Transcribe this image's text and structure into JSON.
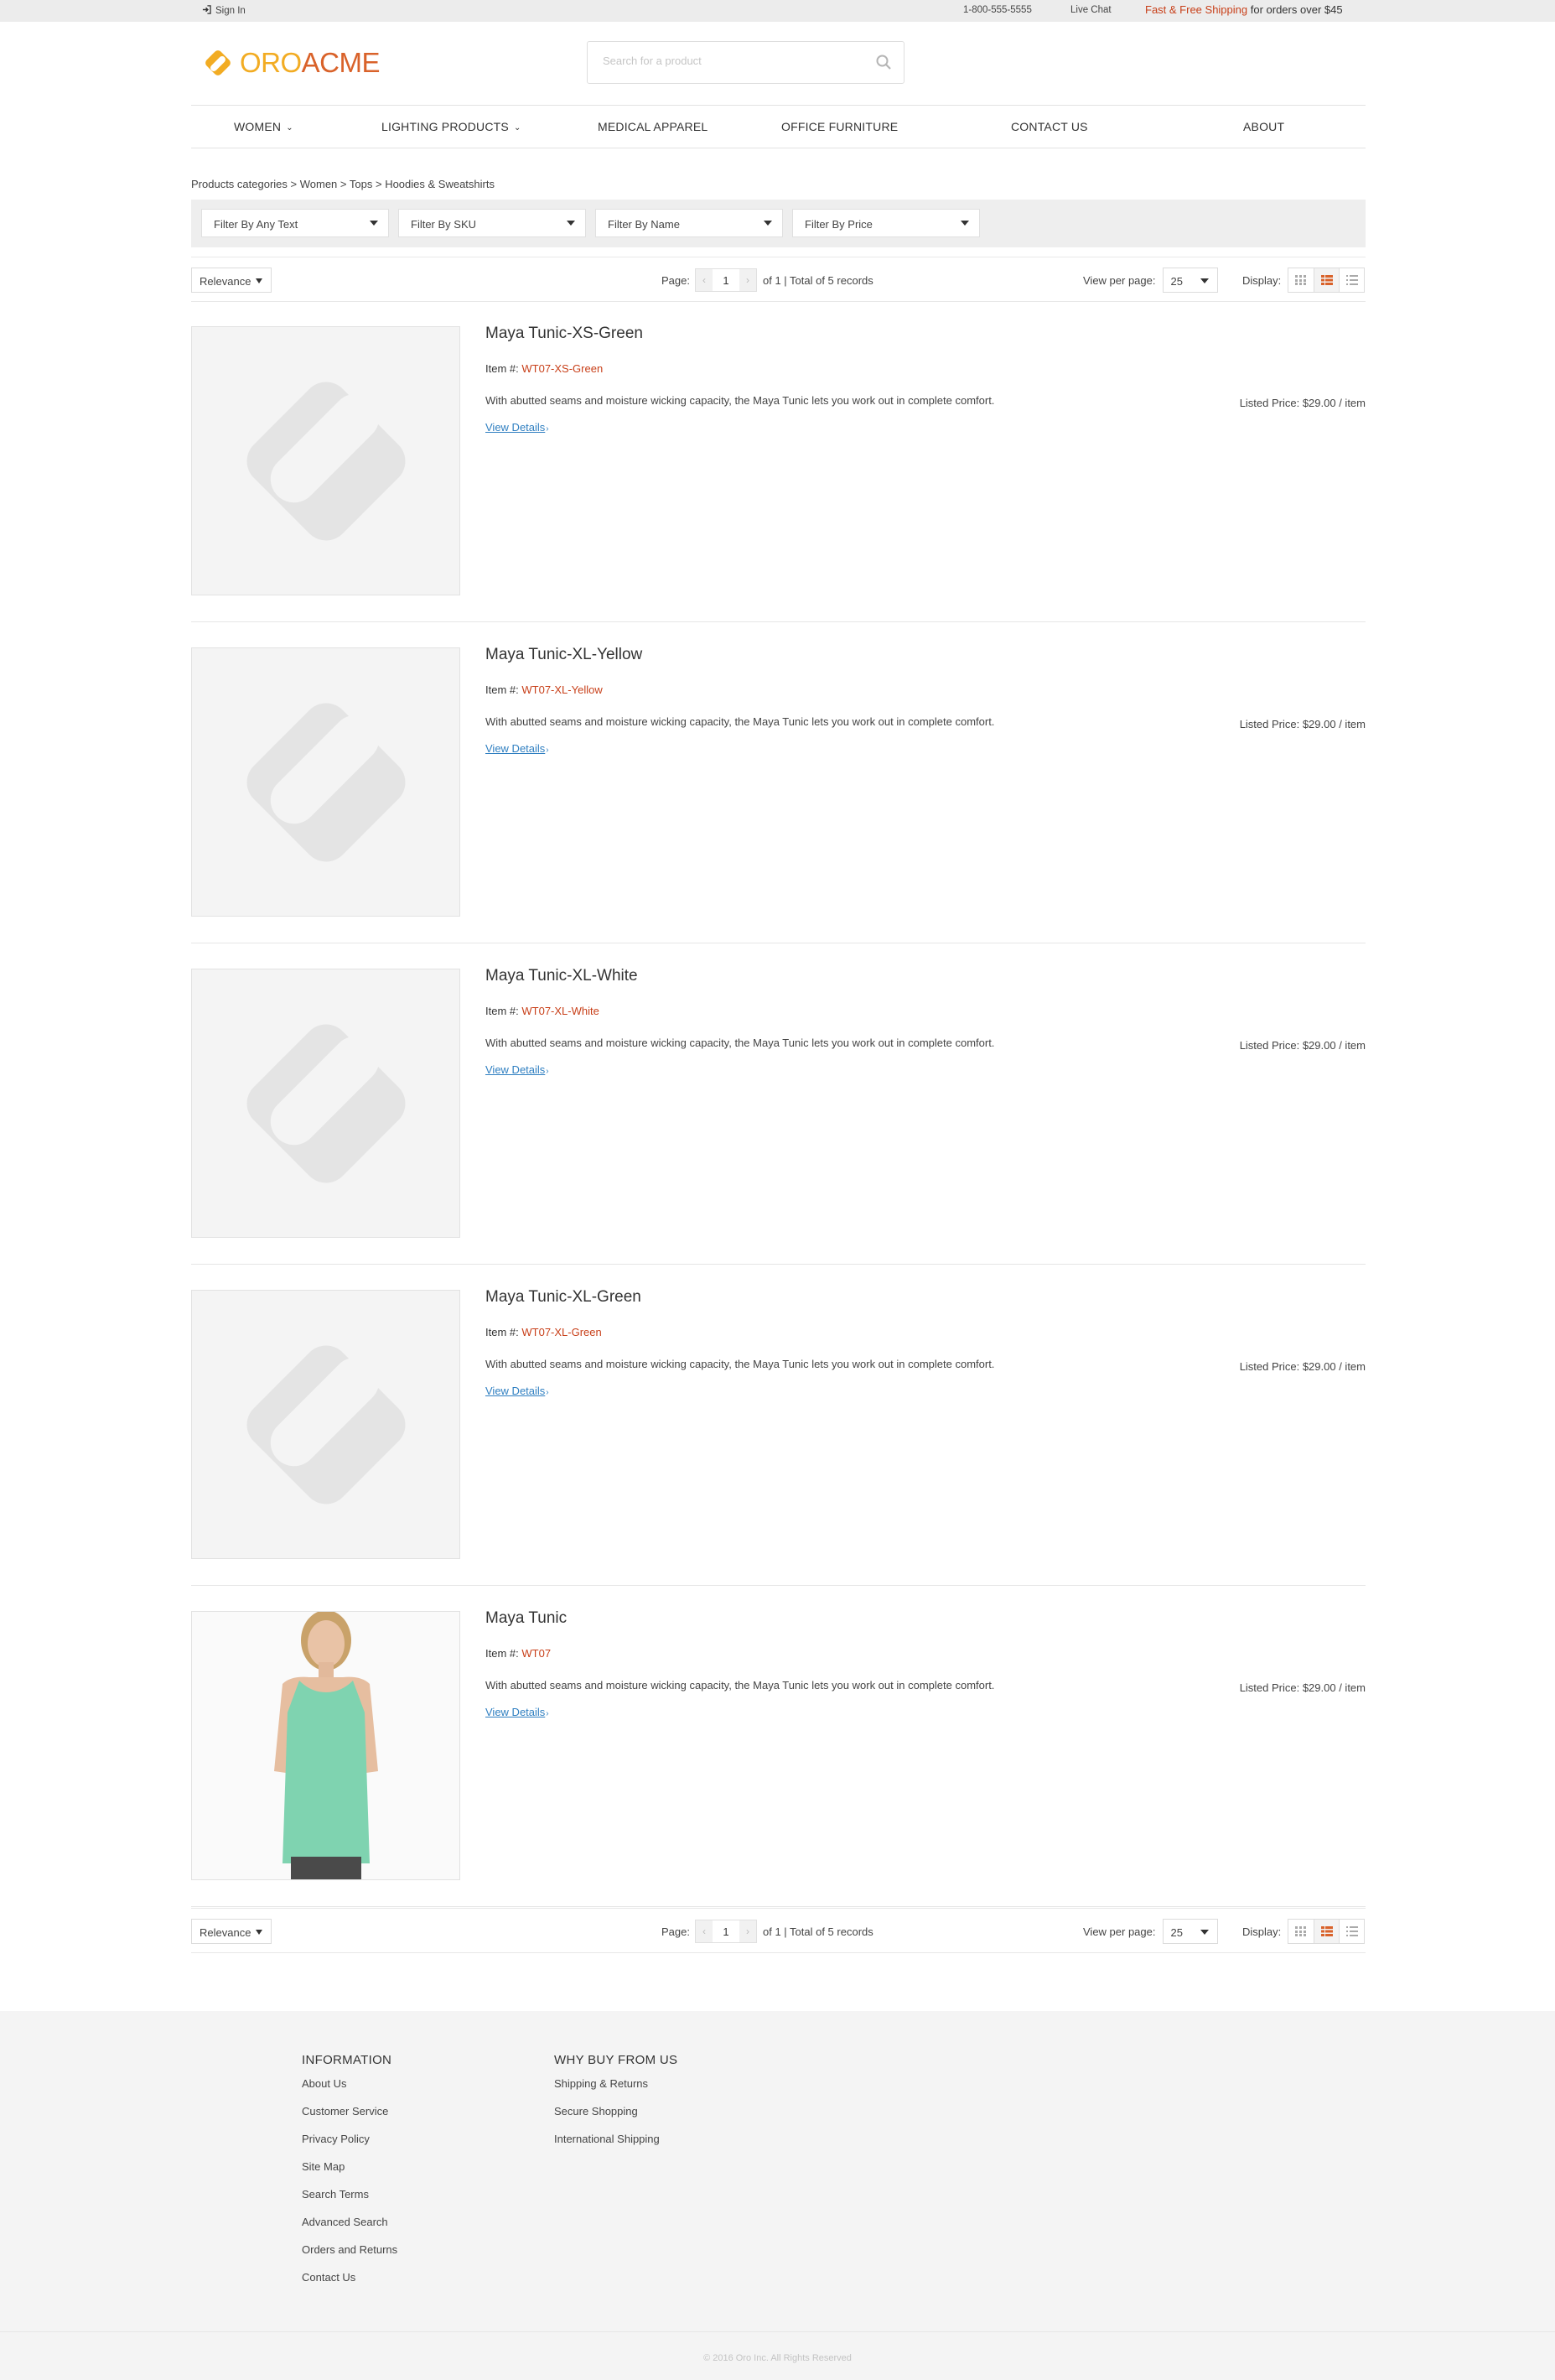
{
  "topbar": {
    "signin": "Sign In",
    "phone": "1-800-555-5555",
    "live_chat": "Live Chat",
    "shipping_highlight": "Fast & Free Shipping",
    "shipping_rest": " for orders over $45"
  },
  "logo": {
    "oro": "ORO",
    "acme": "ACME"
  },
  "search": {
    "placeholder": "Search for a product"
  },
  "nav": [
    {
      "label": "WOMEN",
      "dropdown": true
    },
    {
      "label": "LIGHTING PRODUCTS",
      "dropdown": true
    },
    {
      "label": "MEDICAL APPAREL",
      "dropdown": false
    },
    {
      "label": "OFFICE FURNITURE",
      "dropdown": false
    },
    {
      "label": "CONTACT US",
      "dropdown": false
    },
    {
      "label": "ABOUT",
      "dropdown": false
    }
  ],
  "breadcrumb": [
    "Products categories",
    "Women",
    "Tops",
    "Hoodies & Sweatshirts"
  ],
  "filters": [
    "Filter By Any Text",
    "Filter By SKU",
    "Filter By Name",
    "Filter By Price"
  ],
  "toolbar": {
    "sort": "Relevance",
    "page_label": "Page:",
    "page_value": "1",
    "page_total": "of 1 | Total of 5 records",
    "per_page_label": "View per page:",
    "per_page_value": "25",
    "display_label": "Display:",
    "display_modes": [
      "gallery",
      "list-with-images",
      "compact-list"
    ],
    "active_display_mode": "list-with-images"
  },
  "products": [
    {
      "name": "Maya Tunic-XS-Green",
      "item_label": "Item #:",
      "sku": "WT07-XS-Green",
      "description": "With abutted seams and moisture wicking capacity, the Maya Tunic lets you work out in complete comfort.",
      "details": "View Details",
      "price": "Listed Price: $29.00 / item",
      "image": "placeholder"
    },
    {
      "name": "Maya Tunic-XL-Yellow",
      "item_label": "Item #:",
      "sku": "WT07-XL-Yellow",
      "description": "With abutted seams and moisture wicking capacity, the Maya Tunic lets you work out in complete comfort.",
      "details": "View Details",
      "price": "Listed Price: $29.00 / item",
      "image": "placeholder"
    },
    {
      "name": "Maya Tunic-XL-White",
      "item_label": "Item #:",
      "sku": "WT07-XL-White",
      "description": "With abutted seams and moisture wicking capacity, the Maya Tunic lets you work out in complete comfort.",
      "details": "View Details",
      "price": "Listed Price: $29.00 / item",
      "image": "placeholder"
    },
    {
      "name": "Maya Tunic-XL-Green",
      "item_label": "Item #:",
      "sku": "WT07-XL-Green",
      "description": "With abutted seams and moisture wicking capacity, the Maya Tunic lets you work out in complete comfort.",
      "details": "View Details",
      "price": "Listed Price: $29.00 / item",
      "image": "placeholder"
    },
    {
      "name": "Maya Tunic",
      "item_label": "Item #:",
      "sku": "WT07",
      "description": "With abutted seams and moisture wicking capacity, the Maya Tunic lets you work out in complete comfort.",
      "details": "View Details",
      "price": "Listed Price: $29.00 / item",
      "image": "photo-mint-tank-top"
    }
  ],
  "footer": {
    "information": {
      "title": "INFORMATION",
      "links": [
        "About Us",
        "Customer Service",
        "Privacy Policy",
        "Site Map",
        "Search Terms",
        "Advanced Search",
        "Orders and Returns",
        "Contact Us"
      ]
    },
    "why_buy": {
      "title": "WHY BUY FROM US",
      "links": [
        "Shipping & Returns",
        "Secure Shopping",
        "International Shipping"
      ]
    },
    "copyright": "© 2016 Oro Inc. All Rights Reserved"
  },
  "colors": {
    "accent": "#c8401a",
    "link": "#2f7fc1",
    "logo_orange": "#d9622a",
    "logo_yellow": "#f2ac23",
    "mint_tank": "#7fd3b0"
  }
}
